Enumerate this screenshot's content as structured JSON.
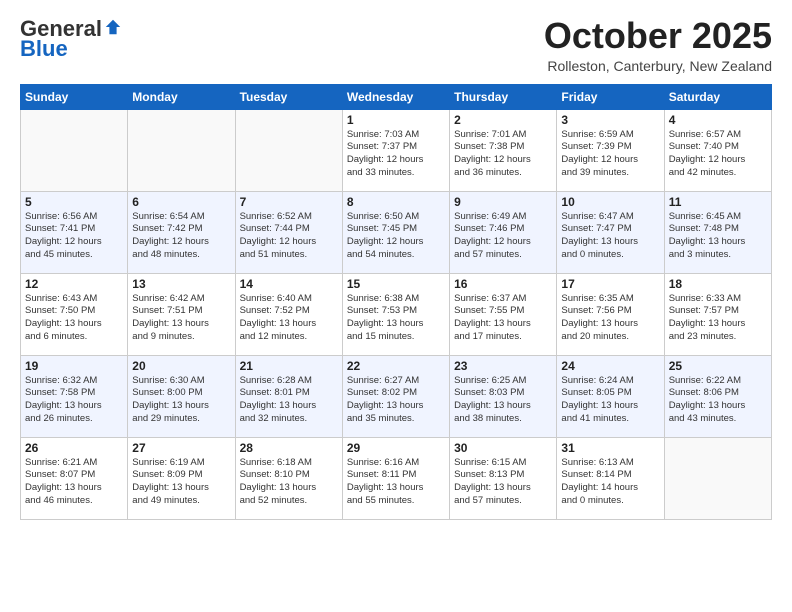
{
  "logo": {
    "general": "General",
    "blue": "Blue"
  },
  "title": "October 2025",
  "location": "Rolleston, Canterbury, New Zealand",
  "days_of_week": [
    "Sunday",
    "Monday",
    "Tuesday",
    "Wednesday",
    "Thursday",
    "Friday",
    "Saturday"
  ],
  "weeks": [
    [
      {
        "day": "",
        "info": ""
      },
      {
        "day": "",
        "info": ""
      },
      {
        "day": "",
        "info": ""
      },
      {
        "day": "1",
        "info": "Sunrise: 7:03 AM\nSunset: 7:37 PM\nDaylight: 12 hours\nand 33 minutes."
      },
      {
        "day": "2",
        "info": "Sunrise: 7:01 AM\nSunset: 7:38 PM\nDaylight: 12 hours\nand 36 minutes."
      },
      {
        "day": "3",
        "info": "Sunrise: 6:59 AM\nSunset: 7:39 PM\nDaylight: 12 hours\nand 39 minutes."
      },
      {
        "day": "4",
        "info": "Sunrise: 6:57 AM\nSunset: 7:40 PM\nDaylight: 12 hours\nand 42 minutes."
      }
    ],
    [
      {
        "day": "5",
        "info": "Sunrise: 6:56 AM\nSunset: 7:41 PM\nDaylight: 12 hours\nand 45 minutes."
      },
      {
        "day": "6",
        "info": "Sunrise: 6:54 AM\nSunset: 7:42 PM\nDaylight: 12 hours\nand 48 minutes."
      },
      {
        "day": "7",
        "info": "Sunrise: 6:52 AM\nSunset: 7:44 PM\nDaylight: 12 hours\nand 51 minutes."
      },
      {
        "day": "8",
        "info": "Sunrise: 6:50 AM\nSunset: 7:45 PM\nDaylight: 12 hours\nand 54 minutes."
      },
      {
        "day": "9",
        "info": "Sunrise: 6:49 AM\nSunset: 7:46 PM\nDaylight: 12 hours\nand 57 minutes."
      },
      {
        "day": "10",
        "info": "Sunrise: 6:47 AM\nSunset: 7:47 PM\nDaylight: 13 hours\nand 0 minutes."
      },
      {
        "day": "11",
        "info": "Sunrise: 6:45 AM\nSunset: 7:48 PM\nDaylight: 13 hours\nand 3 minutes."
      }
    ],
    [
      {
        "day": "12",
        "info": "Sunrise: 6:43 AM\nSunset: 7:50 PM\nDaylight: 13 hours\nand 6 minutes."
      },
      {
        "day": "13",
        "info": "Sunrise: 6:42 AM\nSunset: 7:51 PM\nDaylight: 13 hours\nand 9 minutes."
      },
      {
        "day": "14",
        "info": "Sunrise: 6:40 AM\nSunset: 7:52 PM\nDaylight: 13 hours\nand 12 minutes."
      },
      {
        "day": "15",
        "info": "Sunrise: 6:38 AM\nSunset: 7:53 PM\nDaylight: 13 hours\nand 15 minutes."
      },
      {
        "day": "16",
        "info": "Sunrise: 6:37 AM\nSunset: 7:55 PM\nDaylight: 13 hours\nand 17 minutes."
      },
      {
        "day": "17",
        "info": "Sunrise: 6:35 AM\nSunset: 7:56 PM\nDaylight: 13 hours\nand 20 minutes."
      },
      {
        "day": "18",
        "info": "Sunrise: 6:33 AM\nSunset: 7:57 PM\nDaylight: 13 hours\nand 23 minutes."
      }
    ],
    [
      {
        "day": "19",
        "info": "Sunrise: 6:32 AM\nSunset: 7:58 PM\nDaylight: 13 hours\nand 26 minutes."
      },
      {
        "day": "20",
        "info": "Sunrise: 6:30 AM\nSunset: 8:00 PM\nDaylight: 13 hours\nand 29 minutes."
      },
      {
        "day": "21",
        "info": "Sunrise: 6:28 AM\nSunset: 8:01 PM\nDaylight: 13 hours\nand 32 minutes."
      },
      {
        "day": "22",
        "info": "Sunrise: 6:27 AM\nSunset: 8:02 PM\nDaylight: 13 hours\nand 35 minutes."
      },
      {
        "day": "23",
        "info": "Sunrise: 6:25 AM\nSunset: 8:03 PM\nDaylight: 13 hours\nand 38 minutes."
      },
      {
        "day": "24",
        "info": "Sunrise: 6:24 AM\nSunset: 8:05 PM\nDaylight: 13 hours\nand 41 minutes."
      },
      {
        "day": "25",
        "info": "Sunrise: 6:22 AM\nSunset: 8:06 PM\nDaylight: 13 hours\nand 43 minutes."
      }
    ],
    [
      {
        "day": "26",
        "info": "Sunrise: 6:21 AM\nSunset: 8:07 PM\nDaylight: 13 hours\nand 46 minutes."
      },
      {
        "day": "27",
        "info": "Sunrise: 6:19 AM\nSunset: 8:09 PM\nDaylight: 13 hours\nand 49 minutes."
      },
      {
        "day": "28",
        "info": "Sunrise: 6:18 AM\nSunset: 8:10 PM\nDaylight: 13 hours\nand 52 minutes."
      },
      {
        "day": "29",
        "info": "Sunrise: 6:16 AM\nSunset: 8:11 PM\nDaylight: 13 hours\nand 55 minutes."
      },
      {
        "day": "30",
        "info": "Sunrise: 6:15 AM\nSunset: 8:13 PM\nDaylight: 13 hours\nand 57 minutes."
      },
      {
        "day": "31",
        "info": "Sunrise: 6:13 AM\nSunset: 8:14 PM\nDaylight: 14 hours\nand 0 minutes."
      },
      {
        "day": "",
        "info": ""
      }
    ]
  ]
}
